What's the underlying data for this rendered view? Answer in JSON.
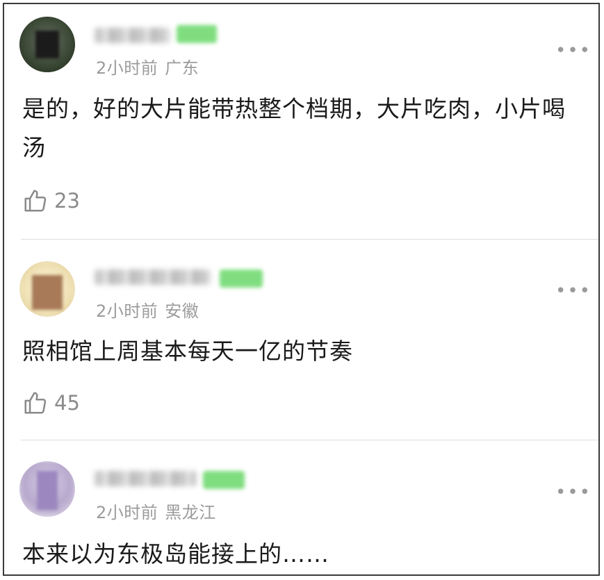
{
  "comments": [
    {
      "meta_time": "2小时前",
      "meta_location": "广东",
      "text": "是的，好的大片能带热整个档期，大片吃肉，小片喝汤",
      "likes": "23",
      "more_icon": "more-dots-icon",
      "like_icon": "thumbs-up-icon"
    },
    {
      "meta_time": "2小时前",
      "meta_location": "安徽",
      "text": "照相馆上周基本每天一亿的节奏",
      "likes": "45",
      "more_icon": "more-dots-icon",
      "like_icon": "thumbs-up-icon"
    },
    {
      "meta_time": "2小时前",
      "meta_location": "黑龙江",
      "text": "本来以为东极岛能接上的……",
      "more_icon": "more-dots-icon"
    }
  ],
  "more_glyph": "•••",
  "colors": {
    "meta": "#9b9b9b",
    "text": "#1a1a1a",
    "badge": "#7fdd7f",
    "divider": "#dddddd"
  }
}
